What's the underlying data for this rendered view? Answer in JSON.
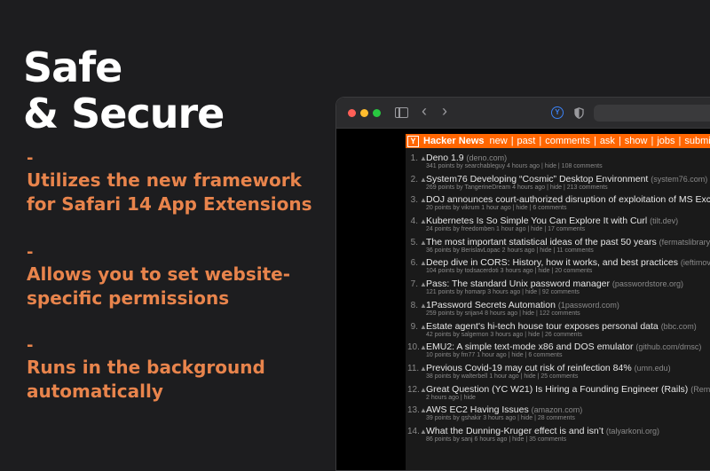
{
  "promo": {
    "headline_line1": "Safe",
    "headline_line2": "& Secure",
    "dash": "-",
    "features": [
      {
        "line1": "Utilizes the new framework",
        "line2": "for Safari 14 App Extensions"
      },
      {
        "line1": "Allows you to set website-",
        "line2": "specific permissions"
      },
      {
        "line1": "Runs in the background",
        "line2": "automatically"
      }
    ],
    "accent_color": "#e8844c"
  },
  "browser": {
    "toolbar_icons": [
      "sidebar-icon",
      "back-icon",
      "forward-icon",
      "extension-icon",
      "shield-icon"
    ],
    "back_glyph": "‹",
    "forward_glyph": "›",
    "extension_glyph": "Y"
  },
  "hn": {
    "logo": "Y",
    "title": "Hacker News",
    "nav": [
      "new",
      "past",
      "comments",
      "ask",
      "show",
      "jobs",
      "submit"
    ],
    "separator": "|",
    "vote_glyph": "▲",
    "header_color": "#ff6600",
    "stories": [
      {
        "rank": "1.",
        "title": "Deno 1.9",
        "site": "(deno.com)",
        "sub": "341 points by searchableguy 4 hours ago | hide | 108 comments"
      },
      {
        "rank": "2.",
        "title": "System76 Developing “Cosmic” Desktop Environment",
        "site": "(system76.com)",
        "sub": "269 points by TangerineDream 4 hours ago | hide | 213 comments"
      },
      {
        "rank": "3.",
        "title": "DOJ announces court-authorized disruption of exploitation of MS Exchan",
        "site": "",
        "sub": "20 points by vikrum 1 hour ago | hide | 6 comments"
      },
      {
        "rank": "4.",
        "title": "Kubernetes Is So Simple You Can Explore It with Curl",
        "site": "(tilt.dev)",
        "sub": "24 points by freedomben 1 hour ago | hide | 17 comments"
      },
      {
        "rank": "5.",
        "title": "The most important statistical ideas of the past 50 years",
        "site": "(fermatslibrary.co",
        "sub": "36 points by BerislavLopac 2 hours ago | hide | 11 comments"
      },
      {
        "rank": "6.",
        "title": "Deep dive in CORS: History, how it works, and best practices",
        "site": "(ieftimov.co",
        "sub": "104 points by todsacerdoti 3 hours ago | hide | 20 comments"
      },
      {
        "rank": "7.",
        "title": "Pass: The standard Unix password manager",
        "site": "(passwordstore.org)",
        "sub": "121 points by homarp 3 hours ago | hide | 92 comments"
      },
      {
        "rank": "8.",
        "title": "1Password Secrets Automation",
        "site": "(1password.com)",
        "sub": "259 points by srijan4 8 hours ago | hide | 122 comments"
      },
      {
        "rank": "9.",
        "title": "Estate agent's hi-tech house tour exposes personal data",
        "site": "(bbc.com)",
        "sub": "42 points by salgernon 3 hours ago | hide | 26 comments"
      },
      {
        "rank": "10.",
        "title": "EMU2: A simple text-mode x86 and DOS emulator",
        "site": "(github.com/dmsc)",
        "sub": "10 points by fm77 1 hour ago | hide | 6 comments"
      },
      {
        "rank": "11.",
        "title": "Previous Covid-19 may cut risk of reinfection 84%",
        "site": "(umn.edu)",
        "sub": "38 points by walterbell 1 hour ago | hide | 25 comments"
      },
      {
        "rank": "12.",
        "title": "Great Question (YC W21) Is Hiring a Founding Engineer (Rails)",
        "site": "(Remote",
        "sub": "2 hours ago | hide"
      },
      {
        "rank": "13.",
        "title": "AWS EC2 Having Issues",
        "site": "(amazon.com)",
        "sub": "39 points by gshakir 3 hours ago | hide | 28 comments"
      },
      {
        "rank": "14.",
        "title": "What the Dunning-Kruger effect is and isn’t",
        "site": "(talyarkoni.org)",
        "sub": "86 points by sanj 6 hours ago | hide | 35 comments"
      }
    ]
  }
}
